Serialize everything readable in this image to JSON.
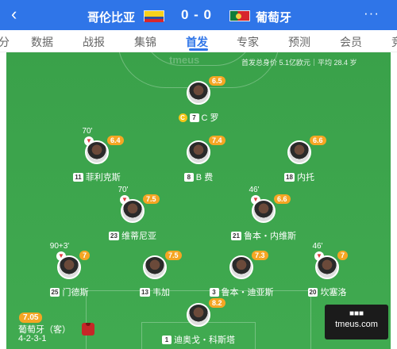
{
  "header": {
    "back_icon": "‹",
    "home_team": "哥伦比亚",
    "score": "0 - 0",
    "away_team": "葡萄牙",
    "more_icon": "···",
    "colors": {
      "bar": "#2f75e8"
    }
  },
  "tabs": [
    "分",
    "数据",
    "战报",
    "集锦",
    "首发",
    "专家",
    "预测",
    "会员",
    "竞"
  ],
  "pitch": {
    "watermark": "tmeus",
    "info": "首发总身价 5.1亿欧元｜平均 28.4 岁",
    "players": [
      {
        "name": "C 罗",
        "number": "7",
        "rating": "6.5",
        "captain": "C",
        "sub_time": ""
      },
      {
        "name": "菲利克斯",
        "number": "11",
        "rating": "6.4",
        "captain": "",
        "sub_time": "70'"
      },
      {
        "name": "B 费",
        "number": "8",
        "rating": "7.4",
        "captain": "",
        "sub_time": ""
      },
      {
        "name": "内托",
        "number": "18",
        "rating": "6.6",
        "captain": "",
        "sub_time": ""
      },
      {
        "name": "维蒂尼亚",
        "number": "23",
        "rating": "7.5",
        "captain": "",
        "sub_time": "70'"
      },
      {
        "name": "鲁本・内维斯",
        "number": "21",
        "rating": "6.6",
        "captain": "",
        "sub_time": "46'"
      },
      {
        "name": "门德斯",
        "number": "25",
        "rating": "7",
        "captain": "",
        "sub_time": "90+3'"
      },
      {
        "name": "韦加",
        "number": "13",
        "rating": "7.5",
        "captain": "",
        "sub_time": ""
      },
      {
        "name": "鲁本・迪亚斯",
        "number": "3",
        "rating": "7.3",
        "captain": "",
        "sub_time": ""
      },
      {
        "name": "坎塞洛",
        "number": "20",
        "rating": "7",
        "captain": "",
        "sub_time": "46'"
      },
      {
        "name": "迪奥戈・科斯塔",
        "number": "1",
        "rating": "8.2",
        "captain": "",
        "sub_time": ""
      }
    ]
  },
  "team_panel": {
    "rating": "7.05",
    "side": "葡萄牙（客）",
    "formation": "4-2-3-1"
  },
  "logo": {
    "line1": "■■■",
    "line2": "tmeus.com"
  }
}
